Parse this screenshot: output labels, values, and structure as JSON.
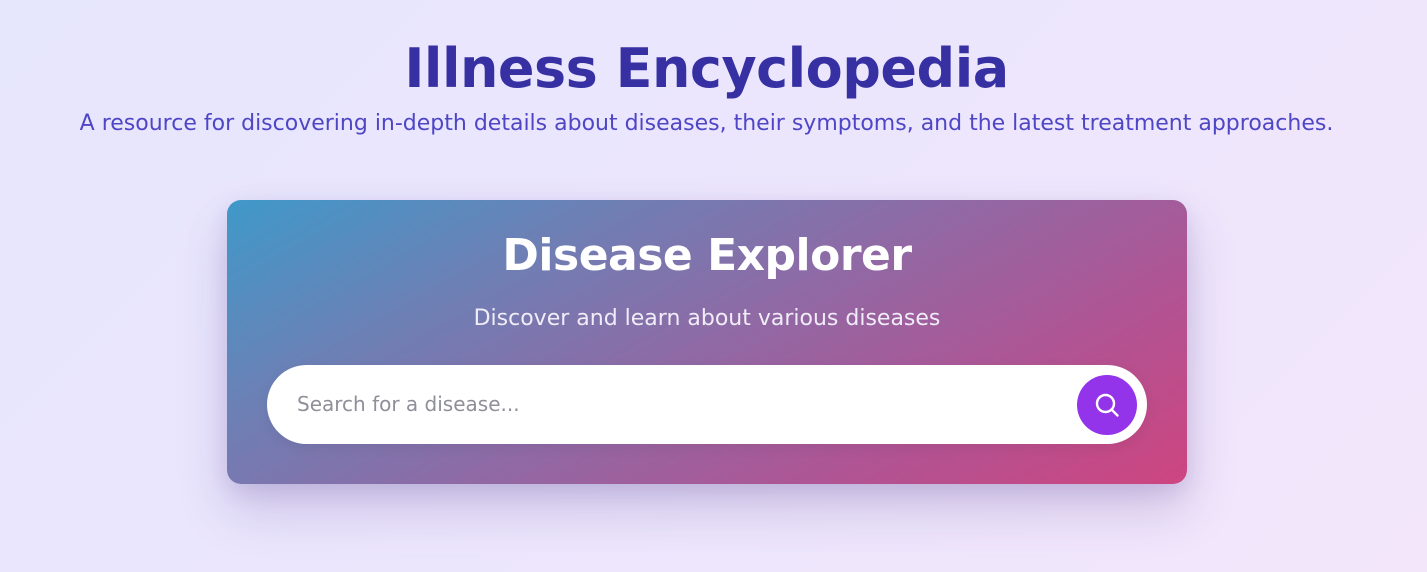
{
  "header": {
    "title": "Illness Encyclopedia",
    "subtitle": "A resource for discovering in-depth details about diseases, their symptoms, and the latest treatment approaches."
  },
  "explorer": {
    "title": "Disease Explorer",
    "subtitle": "Discover and learn about various diseases",
    "search": {
      "placeholder": "Search for a disease...",
      "value": "",
      "button_icon": "search-icon"
    }
  },
  "colors": {
    "title": "#3730a3",
    "subtitle": "#4f46c5",
    "card_gradient_start": "#3f99c9",
    "card_gradient_end": "#cd4580",
    "search_button": "#9333ea"
  }
}
